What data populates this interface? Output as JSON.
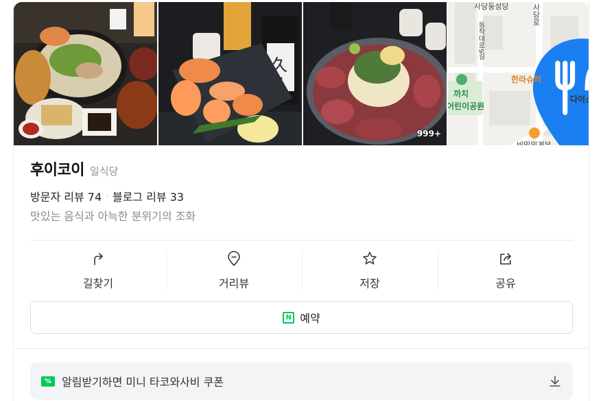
{
  "photos": {
    "count_badge": "999+",
    "items": [
      {
        "name": "hotpot-dishes-photo"
      },
      {
        "name": "salmon-sashimi-photo"
      },
      {
        "name": "beef-tataki-photo"
      }
    ]
  },
  "map": {
    "labels": {
      "street_top": "사당동성당",
      "street_right": "사당로",
      "road_vertical": "동작대로9길",
      "pin_name": "한라슈퍼",
      "park_1": "까치",
      "park_2": "어린이공원",
      "shop_right": "다이소",
      "bottom_place": "비밀의계부"
    },
    "colors": {
      "pin": "#1a7ff0",
      "park": "#2b8a4b"
    }
  },
  "place": {
    "name": "후이코이",
    "category": "일식당",
    "visitor_reviews": "방문자 리뷰 74",
    "blog_reviews": "블로그 리뷰 33",
    "separator": "·",
    "tagline": "맛있는 음식과 아늑한 분위기의 조화"
  },
  "actions": [
    {
      "label": "길찾기",
      "icon": "directions-icon"
    },
    {
      "label": "거리뷰",
      "icon": "street-view-icon"
    },
    {
      "label": "저장",
      "icon": "star-icon"
    },
    {
      "label": "공유",
      "icon": "share-icon"
    }
  ],
  "reserve": {
    "label": "예약",
    "icon_letter": "N",
    "accent": "#03c75a"
  },
  "coupon": {
    "label": "알림받기하면 미니 타코와사비 쿠폰",
    "badge": "%"
  }
}
